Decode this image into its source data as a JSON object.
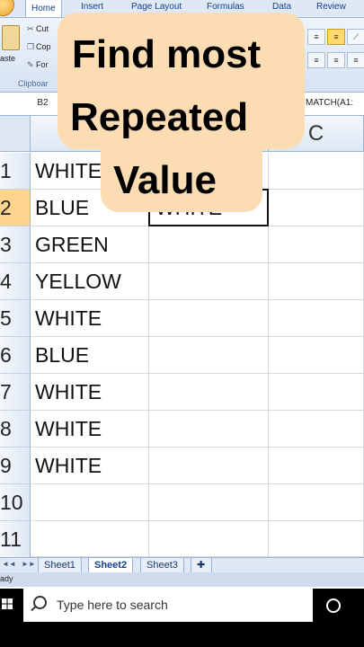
{
  "ribbon": {
    "tabs": [
      "Home",
      "Insert",
      "Page Layout",
      "Formulas",
      "Data",
      "Review"
    ],
    "active_tab": "Home",
    "clipboard": {
      "paste_label": "aste",
      "cut_label": "Cut",
      "copy_label": "Cop",
      "format_label": "For",
      "group_label": "Clipboar"
    }
  },
  "formula_bar": {
    "name_box": "B2",
    "content": "MATCH(A1:"
  },
  "grid": {
    "column_header_visible": "C",
    "rows": [
      "1",
      "2",
      "3",
      "4",
      "5",
      "6",
      "7",
      "8",
      "9",
      "10",
      "11"
    ],
    "selected_row": "2",
    "column_a": [
      "WHITE",
      "BLUE",
      "GREEN",
      "YELLOW",
      "WHITE",
      "BLUE",
      "WHITE",
      "WHITE",
      "WHITE",
      "",
      ""
    ],
    "active_cell_value": "WHITE"
  },
  "overlay_title": {
    "line1": "Find most",
    "line2": "Repeated",
    "line3": "Value",
    "background": "#fbdcb3"
  },
  "sheet_tabs": [
    "Sheet1",
    "Sheet2",
    "Sheet3"
  ],
  "active_sheet": "Sheet2",
  "status": "ady",
  "taskbar": {
    "search_placeholder": "Type here to search"
  }
}
